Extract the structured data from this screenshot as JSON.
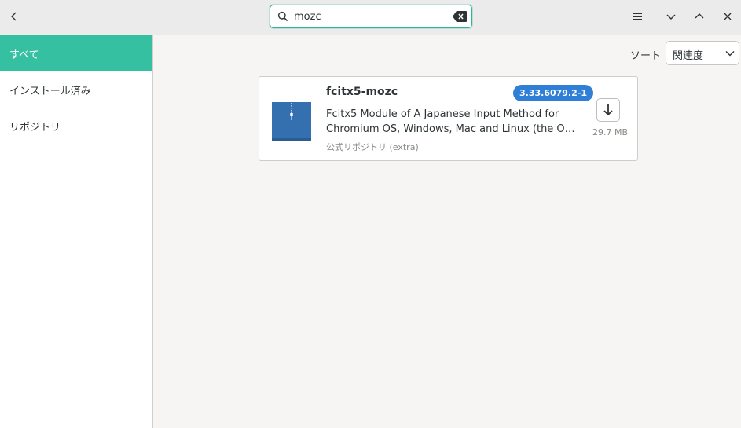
{
  "header": {
    "search": {
      "value": "mozc",
      "placeholder": ""
    },
    "icons": [
      "back-icon",
      "search-icon",
      "clear-icon",
      "menu-icon",
      "chevron-down-icon",
      "chevron-up-icon",
      "close-icon"
    ]
  },
  "sidebar": {
    "items": [
      {
        "label": "すべて",
        "active": true
      },
      {
        "label": "インストール済み",
        "active": false
      },
      {
        "label": "リポジトリ",
        "active": false
      }
    ]
  },
  "toolbar": {
    "sort_label": "ソート",
    "sort_value": "関連度"
  },
  "results": [
    {
      "name": "fcitx5-mozc",
      "version": "3.33.6079.2-1",
      "description_line1": "Fcitx5 Module of A Japanese Input Method for",
      "description_line2": "Chromium OS, Windows, Mac and Linux (the Open Source Edition of Google Japanese Input)",
      "repository": "公式リポジトリ (extra)",
      "size": "29.7 MB"
    }
  ],
  "colors": {
    "accent": "#36c0a2",
    "badge": "#2f7fd6",
    "package_icon": "#3470b0"
  }
}
